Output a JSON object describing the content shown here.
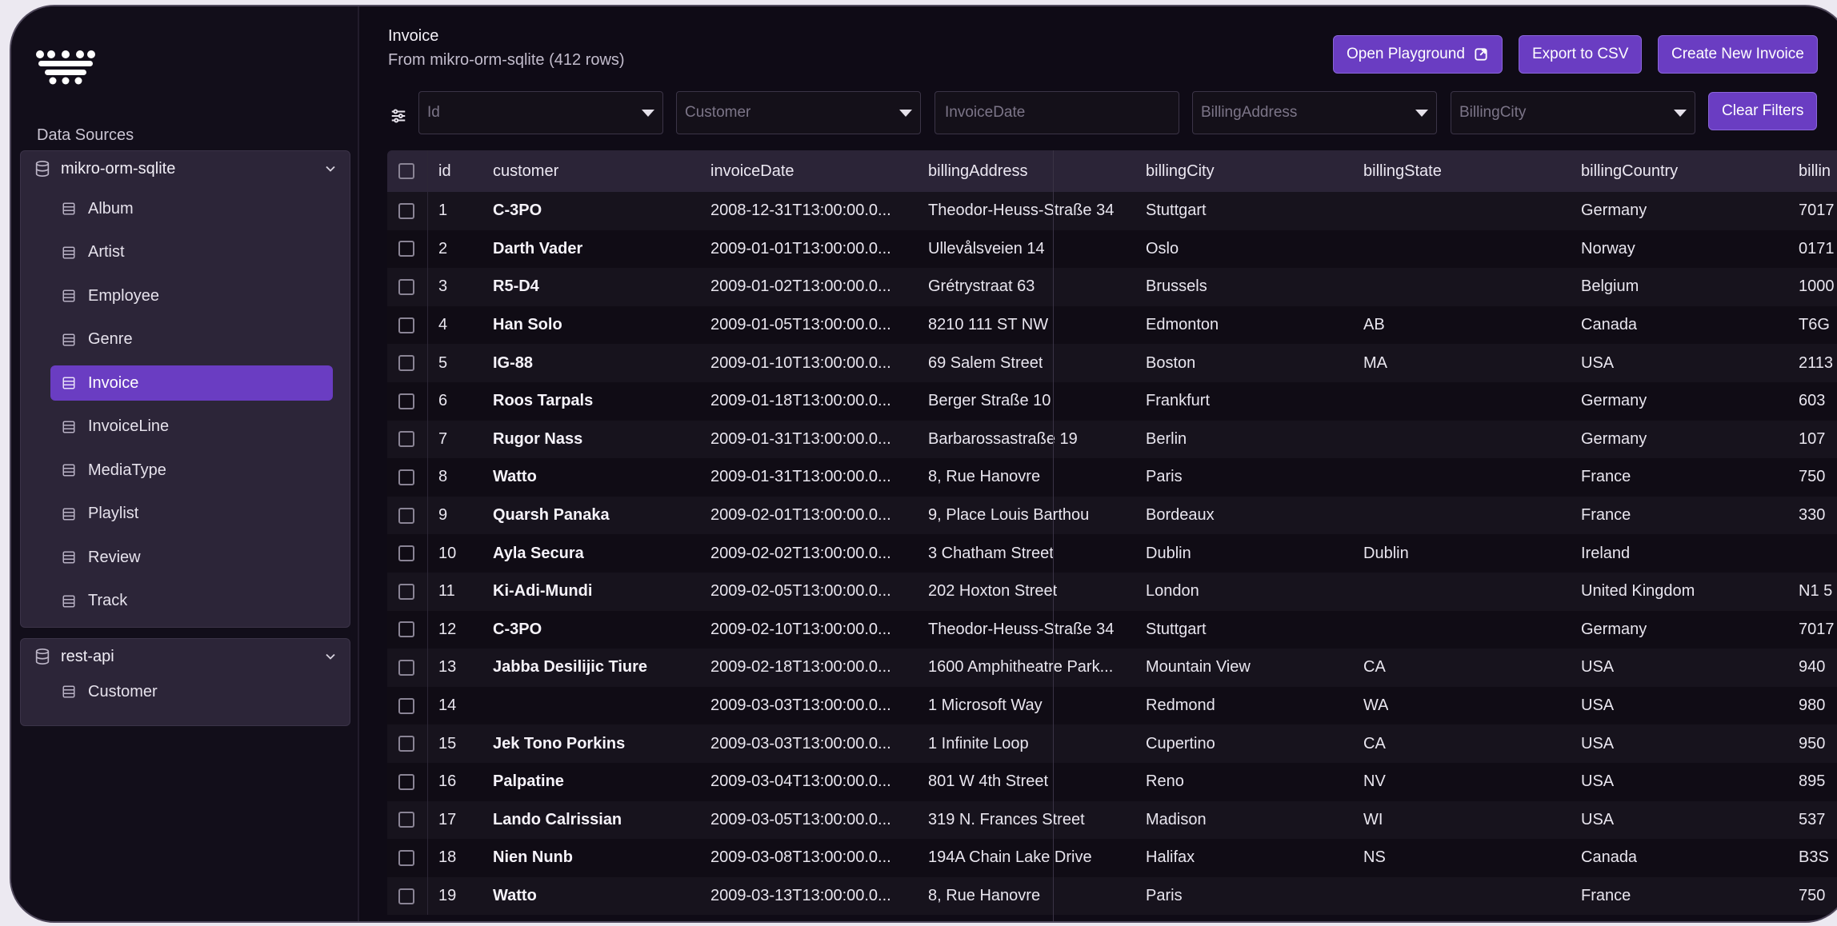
{
  "sidebar": {
    "heading": "Data Sources",
    "sources": [
      {
        "name": "mikro-orm-sqlite",
        "tables": [
          "Album",
          "Artist",
          "Employee",
          "Genre",
          "Invoice",
          "InvoiceLine",
          "MediaType",
          "Playlist",
          "Review",
          "Track"
        ],
        "active": "Invoice"
      },
      {
        "name": "rest-api",
        "tables": [
          "Customer"
        ]
      }
    ]
  },
  "header": {
    "title": "Invoice",
    "subtitle": "From mikro-orm-sqlite (412 rows)",
    "open_playground": "Open Playground",
    "export_csv": "Export to CSV",
    "create_new": "Create New Invoice"
  },
  "filters": {
    "id": "Id",
    "customer": "Customer",
    "invoice_date": "InvoiceDate",
    "billing_address": "BillingAddress",
    "billing_city": "BillingCity",
    "clear": "Clear Filters"
  },
  "table": {
    "columns": [
      "id",
      "customer",
      "invoiceDate",
      "billingAddress",
      "billingCity",
      "billingState",
      "billingCountry",
      "billin"
    ],
    "rows": [
      [
        "1",
        "C-3PO",
        "2008-12-31T13:00:00.0...",
        "Theodor-Heuss-Straße 34",
        "Stuttgart",
        "",
        "Germany",
        "7017"
      ],
      [
        "2",
        "Darth Vader",
        "2009-01-01T13:00:00.0...",
        "Ullevålsveien 14",
        "Oslo",
        "",
        "Norway",
        "0171"
      ],
      [
        "3",
        "R5-D4",
        "2009-01-02T13:00:00.0...",
        "Grétrystraat 63",
        "Brussels",
        "",
        "Belgium",
        "1000"
      ],
      [
        "4",
        "Han Solo",
        "2009-01-05T13:00:00.0...",
        "8210 111 ST NW",
        "Edmonton",
        "AB",
        "Canada",
        "T6G"
      ],
      [
        "5",
        "IG-88",
        "2009-01-10T13:00:00.0...",
        "69 Salem Street",
        "Boston",
        "MA",
        "USA",
        "2113"
      ],
      [
        "6",
        "Roos Tarpals",
        "2009-01-18T13:00:00.0...",
        "Berger Straße 10",
        "Frankfurt",
        "",
        "Germany",
        "603"
      ],
      [
        "7",
        "Rugor Nass",
        "2009-01-31T13:00:00.0...",
        "Barbarossastraße 19",
        "Berlin",
        "",
        "Germany",
        "107"
      ],
      [
        "8",
        "Watto",
        "2009-01-31T13:00:00.0...",
        "8, Rue Hanovre",
        "Paris",
        "",
        "France",
        "750"
      ],
      [
        "9",
        "Quarsh Panaka",
        "2009-02-01T13:00:00.0...",
        "9, Place Louis Barthou",
        "Bordeaux",
        "",
        "France",
        "330"
      ],
      [
        "10",
        "Ayla Secura",
        "2009-02-02T13:00:00.0...",
        "3 Chatham Street",
        "Dublin",
        "Dublin",
        "Ireland",
        ""
      ],
      [
        "11",
        "Ki-Adi-Mundi",
        "2009-02-05T13:00:00.0...",
        "202 Hoxton Street",
        "London",
        "",
        "United Kingdom",
        "N1 5"
      ],
      [
        "12",
        "C-3PO",
        "2009-02-10T13:00:00.0...",
        "Theodor-Heuss-Straße 34",
        "Stuttgart",
        "",
        "Germany",
        "7017"
      ],
      [
        "13",
        "Jabba Desilijic Tiure",
        "2009-02-18T13:00:00.0...",
        "1600 Amphitheatre Park...",
        "Mountain View",
        "CA",
        "USA",
        "940"
      ],
      [
        "14",
        "",
        "2009-03-03T13:00:00.0...",
        "1 Microsoft Way",
        "Redmond",
        "WA",
        "USA",
        "980"
      ],
      [
        "15",
        "Jek Tono Porkins",
        "2009-03-03T13:00:00.0...",
        "1 Infinite Loop",
        "Cupertino",
        "CA",
        "USA",
        "950"
      ],
      [
        "16",
        "Palpatine",
        "2009-03-04T13:00:00.0...",
        "801 W 4th Street",
        "Reno",
        "NV",
        "USA",
        "895"
      ],
      [
        "17",
        "Lando Calrissian",
        "2009-03-05T13:00:00.0...",
        "319 N. Frances Street",
        "Madison",
        "WI",
        "USA",
        "537"
      ],
      [
        "18",
        "Nien Nunb",
        "2009-03-08T13:00:00.0...",
        "194A Chain Lake Drive",
        "Halifax",
        "NS",
        "Canada",
        "B3S"
      ],
      [
        "19",
        "Watto",
        "2009-03-13T13:00:00.0...",
        "8, Rue Hanovre",
        "Paris",
        "",
        "France",
        "750"
      ]
    ]
  },
  "colors": {
    "accent": "#6a3dc2",
    "background": "#0f0b16",
    "sidebar_card": "#2c2538"
  },
  "icons": {
    "logo": "logo-icon",
    "database": "database-icon",
    "table": "table-icon",
    "chevron": "chevron-down-icon",
    "external": "external-link-icon",
    "filter": "filter-sliders-icon"
  }
}
